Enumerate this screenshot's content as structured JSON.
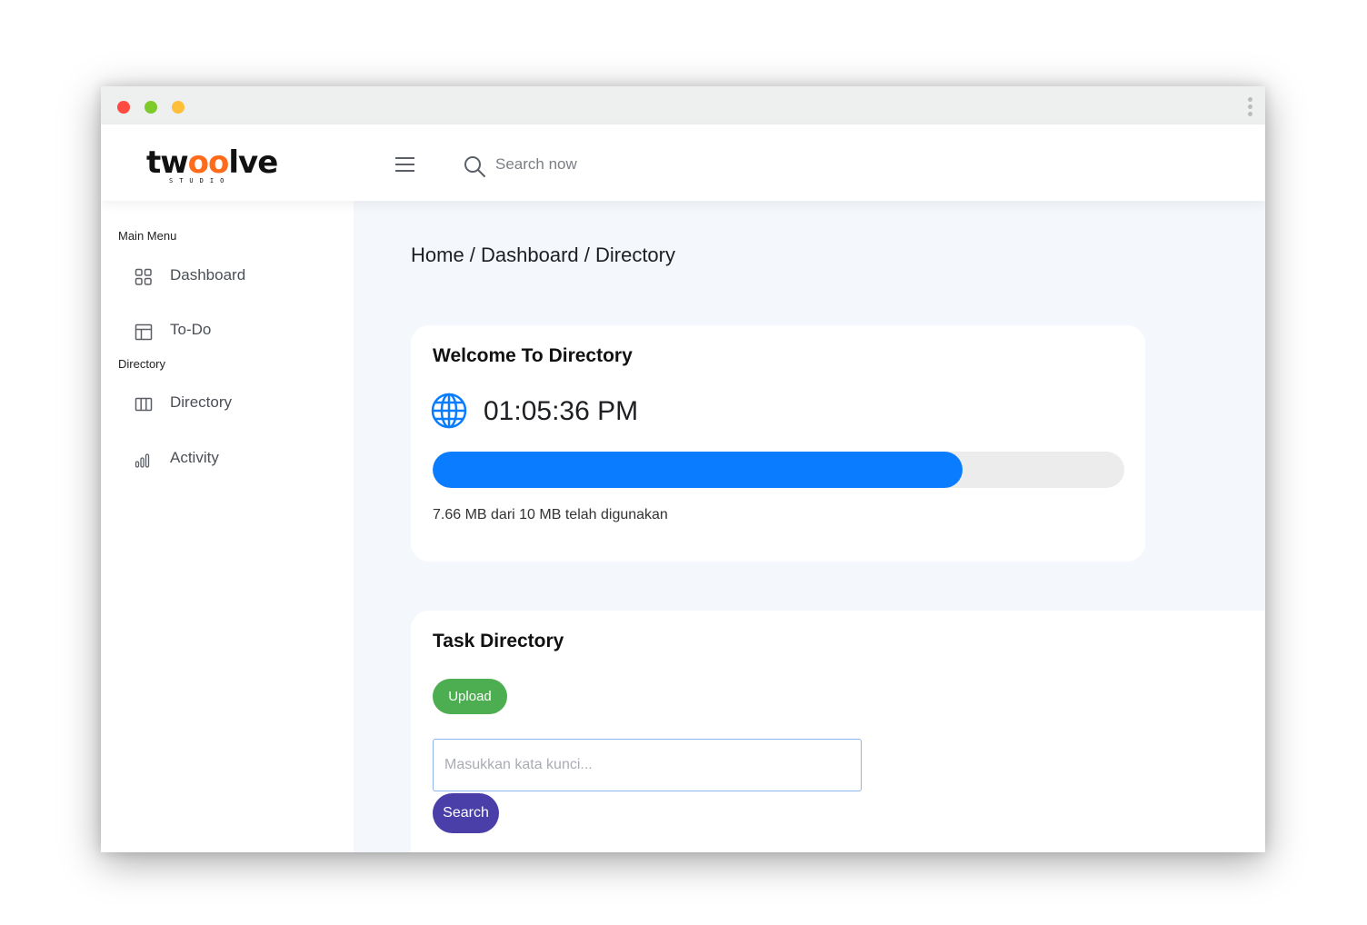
{
  "logo": {
    "part1": "tw",
    "part2": "oo",
    "part3": "lve",
    "sub": "STUDIO"
  },
  "header": {
    "search_placeholder": "Search now"
  },
  "sidebar": {
    "sections": [
      {
        "label": "Main Menu"
      },
      {
        "label": "Directory"
      }
    ],
    "items": [
      {
        "label": "Dashboard",
        "icon": "grid-icon"
      },
      {
        "label": "To-Do",
        "icon": "layout-icon"
      },
      {
        "label": "Directory",
        "icon": "columns-icon"
      },
      {
        "label": "Activity",
        "icon": "bar-chart-icon"
      }
    ]
  },
  "main": {
    "breadcrumb": "Home / Dashboard / Directory",
    "welcome_card": {
      "title": "Welcome To Directory",
      "time": "01:05:36 PM",
      "storage_used_mb": 7.66,
      "storage_total_mb": 10,
      "usage_text": "7.66 MB dari 10 MB telah digunakan"
    },
    "task_card": {
      "title": "Task Directory",
      "upload_label": "Upload",
      "keyword_placeholder": "Masukkan kata kunci...",
      "search_label": "Search"
    }
  },
  "colors": {
    "accent_blue": "#0a7cff",
    "upload_green": "#4cae50",
    "search_purple": "#4a3fa8",
    "logo_orange": "#ff6b1a"
  }
}
